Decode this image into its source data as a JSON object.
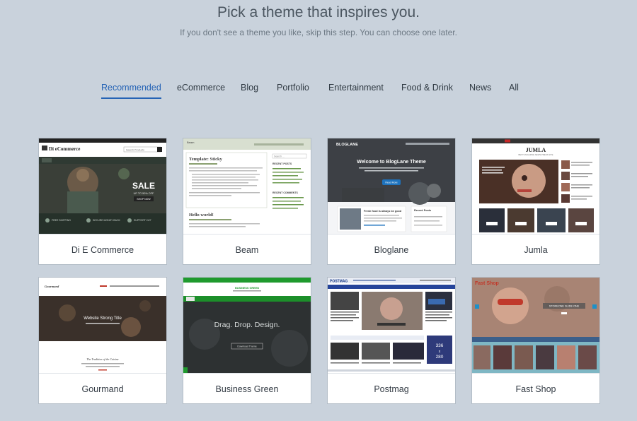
{
  "header": {
    "title": "Pick a theme that inspires you.",
    "subtitle": "If you don't see a theme you like, skip this step. You can choose one later."
  },
  "tabs": [
    {
      "label": "Recommended",
      "active": true
    },
    {
      "label": "eCommerce"
    },
    {
      "label": "Blog"
    },
    {
      "label": "Portfolio"
    },
    {
      "label": "Entertainment"
    },
    {
      "label": "Food & Drink"
    },
    {
      "label": "News"
    },
    {
      "label": "All"
    }
  ],
  "themes": [
    {
      "name": "Di E Commerce",
      "preview": {
        "logo": "Di eCommerce",
        "search_placeholder": "Search Products",
        "hero_line1": "SALE",
        "hero_line2": "UP TO 50% OFF",
        "hero_button": "SHOP NOW",
        "features": [
          "FREE SHIPPING",
          "SECURE MONEY BACK",
          "SUPPORT 24/7"
        ]
      }
    },
    {
      "name": "Beam",
      "preview": {
        "site": "Beam",
        "post1_title": "Template: Sticky",
        "post2_title": "Hello world!",
        "search_placeholder": "Search ...",
        "widget1": "RECENT POSTS",
        "widget2": "RECENT COMMENTS"
      }
    },
    {
      "name": "Bloglane",
      "preview": {
        "logo": "BLOGLANE",
        "hero_title": "Welcome to BlogLane Theme",
        "hero_button": "Read More",
        "post_title": "Fresh food is always be good",
        "widget": "Recent Posts"
      }
    },
    {
      "name": "Jumla",
      "preview": {
        "logo": "JUMLA",
        "tagline": "BEST MAGAZINE NEWS PRESS SITE"
      }
    },
    {
      "name": "Gourmand",
      "preview": {
        "logo": "Gourmand",
        "hero_title": "Website Strong Title",
        "section_title": "The Tradition of the Cuisine"
      }
    },
    {
      "name": "Business Green",
      "preview": {
        "logo": "BUSINESS GREEN",
        "hero_title": "Drag. Drop. Design.",
        "hero_button": "Download Theme"
      }
    },
    {
      "name": "Postmag",
      "preview": {
        "logo": "POSTMAG",
        "ad_line1": "336",
        "ad_line2": "x",
        "ad_line3": "280"
      }
    },
    {
      "name": "Fast Shop",
      "preview": {
        "logo": "Fast Shop",
        "slide_label": "STOREONE SLIDE ONE"
      }
    }
  ],
  "colors": {
    "background": "#c9d2dc",
    "accent": "#2563b5",
    "card_border": "#b3bdc7"
  }
}
